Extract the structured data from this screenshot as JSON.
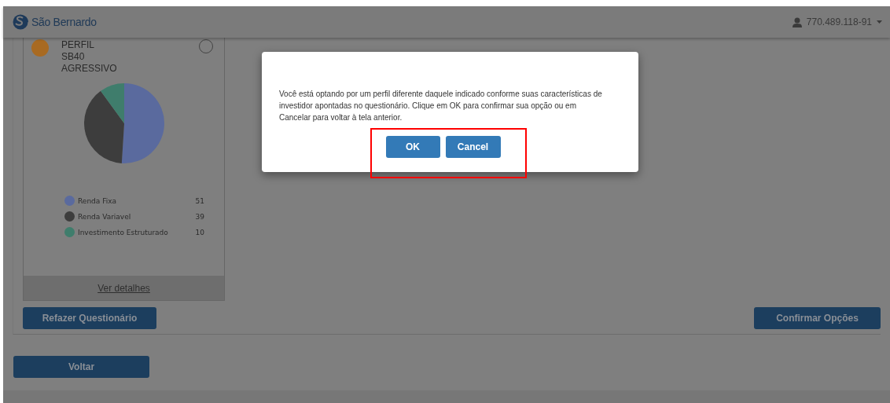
{
  "header": {
    "brand": "São Bernardo",
    "user": "770.489.118-91"
  },
  "profile_card": {
    "heading": "PERFIL",
    "code": "SB40",
    "name": "AGRESSIVO",
    "selected": false,
    "chart_data": {
      "type": "pie",
      "categories": [
        "Renda Fixa",
        "Renda Variavel",
        "Investimento Estruturado"
      ],
      "series": [
        {
          "values": [
            51,
            39,
            10
          ]
        }
      ],
      "colors": [
        "#5a6a9e",
        "#3d3d3d",
        "#3f7d6c"
      ],
      "value_labels": [
        "51",
        "39",
        "10"
      ]
    },
    "details_link": "Ver detalhes"
  },
  "buttons": {
    "redo": "Refazer Questionário",
    "confirm": "Confirmar Opções",
    "back": "Voltar"
  },
  "dialog": {
    "message": "Você está optando por um perfil diferente daquele indicado conforme suas características de investidor apontadas no questionário. Clique em OK para confirmar sua opção ou em Cancelar para voltar à tela anterior.",
    "ok": "OK",
    "cancel": "Cancel"
  }
}
